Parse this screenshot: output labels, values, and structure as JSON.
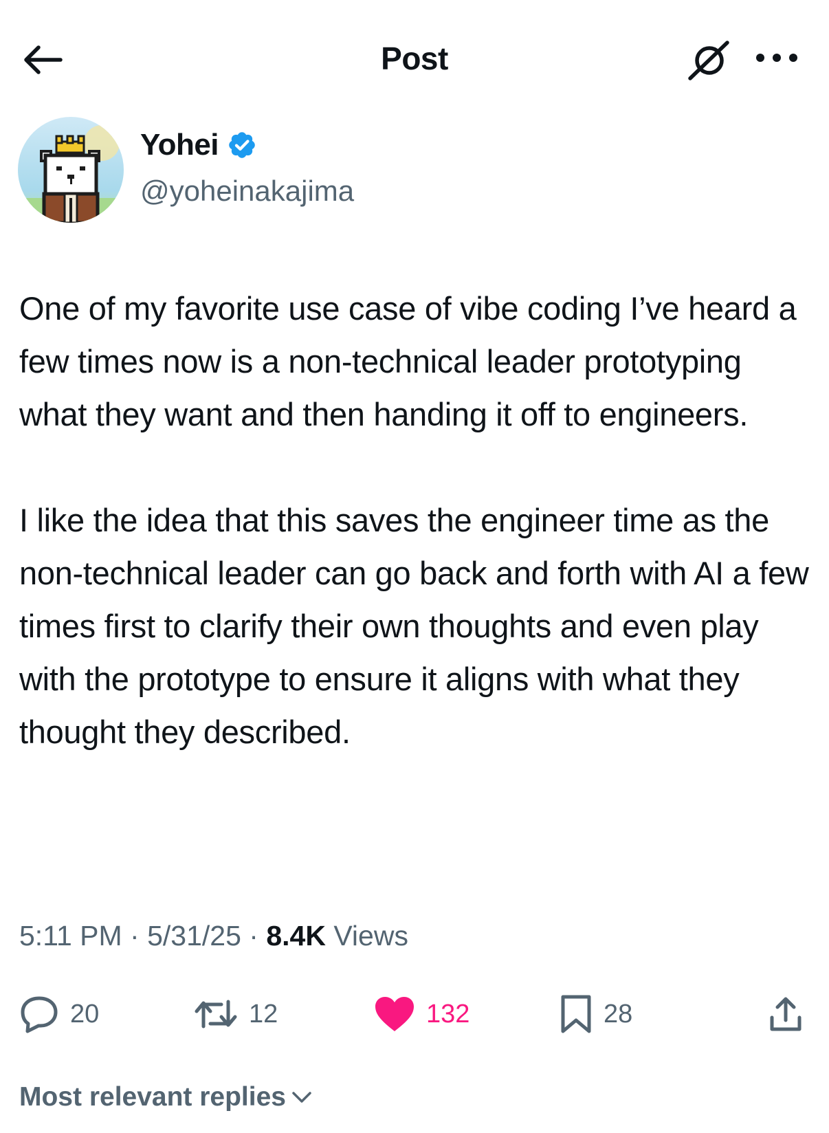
{
  "header": {
    "title": "Post",
    "back_icon": "arrow-left-icon",
    "grok_icon": "grok-icon",
    "more_icon": "more-dots-icon"
  },
  "author": {
    "display_name": "Yohei",
    "handle": "@yoheinakajima",
    "verified": true,
    "verified_color": "#1d9bf0"
  },
  "tweet": {
    "paragraphs": [
      "One of my favorite use case of vibe coding I’ve heard a few times now is a non-technical leader prototyping what they want and then handing it off to engineers.",
      "I like the idea that this saves the engineer time as the non-technical leader can go back and forth with AI a few times first to clarify their own thoughts and even play with the prototype to ensure it aligns with what they thought they described."
    ]
  },
  "meta": {
    "time": "5:11 PM",
    "separator": " · ",
    "date": "5/31/25",
    "views_count": "8.4K",
    "views_label": " Views"
  },
  "actions": {
    "replies": "20",
    "reposts": "12",
    "likes": "132",
    "bookmarks": "28",
    "like_color": "#f91880"
  },
  "replies_sort": {
    "label": "Most relevant replies"
  }
}
